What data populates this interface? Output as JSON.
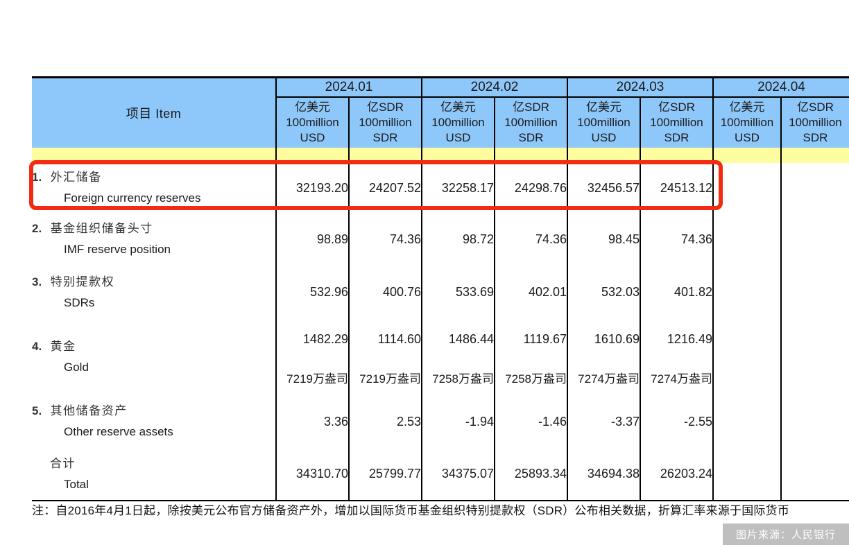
{
  "table": {
    "item_header": "项目  Item",
    "periods": [
      {
        "label": "2024.01",
        "has_data": true
      },
      {
        "label": "2024.02",
        "has_data": true
      },
      {
        "label": "2024.03",
        "has_data": true
      },
      {
        "label": "2024.04",
        "has_data": false
      }
    ],
    "unit_usd": {
      "line1": "亿美元",
      "line2": "100million",
      "line3": "USD"
    },
    "unit_sdr": {
      "line1": "亿SDR",
      "line2": "100million",
      "line3": "SDR"
    },
    "rows": [
      {
        "index": "1.",
        "name_cn": "外汇储备",
        "name_en": "Foreign currency reserves",
        "values": [
          "32193.20",
          "24207.52",
          "32258.17",
          "24298.76",
          "32456.57",
          "24513.12",
          "",
          ""
        ],
        "highlighted": true
      },
      {
        "index": "2.",
        "name_cn": "基金组织储备头寸",
        "name_en": "IMF reserve position",
        "values": [
          "98.89",
          "74.36",
          "98.72",
          "74.36",
          "98.45",
          "74.36",
          "",
          ""
        ],
        "highlighted": false
      },
      {
        "index": "3.",
        "name_cn": "特别提款权",
        "name_en": "SDRs",
        "values": [
          "532.96",
          "400.76",
          "533.69",
          "402.01",
          "532.03",
          "401.82",
          "",
          ""
        ],
        "highlighted": false
      },
      {
        "index": "4.",
        "name_cn": "黄金",
        "name_en": "Gold",
        "values": [
          "1482.29",
          "1114.60",
          "1486.44",
          "1119.67",
          "1610.69",
          "1216.49",
          "",
          ""
        ],
        "values_ounces": [
          "7219万盎司",
          "7219万盎司",
          "7258万盎司",
          "7258万盎司",
          "7274万盎司",
          "7274万盎司",
          "",
          ""
        ],
        "highlighted": false
      },
      {
        "index": "5.",
        "name_cn": "其他储备资产",
        "name_en": "Other reserve assets",
        "values": [
          "3.36",
          "2.53",
          "-1.94",
          "-1.46",
          "-3.37",
          "-2.55",
          "",
          ""
        ],
        "highlighted": false
      },
      {
        "index": "",
        "name_cn": "合计",
        "name_en": "Total",
        "values": [
          "34310.70",
          "25799.77",
          "34375.07",
          "25893.34",
          "34694.38",
          "26203.24",
          "",
          ""
        ],
        "highlighted": false
      }
    ]
  },
  "footnote": "注：自2016年4月1日起，除按美元公布官方储备资产外，增加以国际货币基金组织特别提款权（SDR）公布相关数据，折算汇率来源于国际货币",
  "watermark": "图片来源：人民银行",
  "colors": {
    "header_blue": "#8ec8fa",
    "header_yellow": "#fdfda0",
    "highlight_red": "#f42b10",
    "watermark_bg": "#bfbfbf"
  }
}
